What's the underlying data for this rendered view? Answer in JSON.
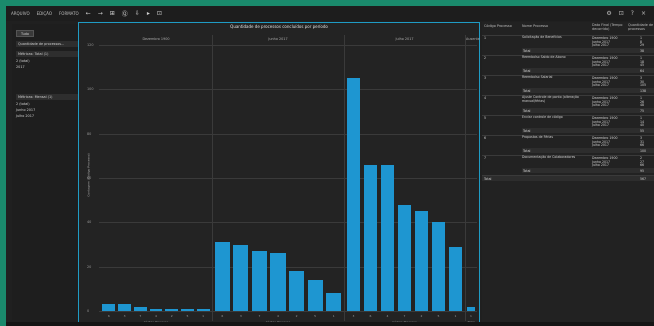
{
  "menu": {
    "items": [
      "ARQUIVO",
      "EDIÇÃO",
      "FORMATO"
    ],
    "tools": [
      "←",
      "→",
      "⊞",
      "Ⓠ",
      "⇩",
      "▸",
      "⊡"
    ],
    "right_tools": [
      "⚙",
      "⊡",
      "?",
      "×"
    ]
  },
  "left": {
    "button": "Tudo",
    "field_title": "Quantidade de processos...",
    "filter1_title": "Métricas: Total (1)",
    "filter1_items": [
      "2 (total)",
      "2017"
    ],
    "filter2_title": "Métricas: Mensal (1)",
    "filter2_items": [
      "2 (total)",
      "Junho 2017",
      "Julho 2017"
    ]
  },
  "chart_data": {
    "type": "bar",
    "title": "Quantidade de processos concluídos por período",
    "ylabel": "Contagem (Código Processo)",
    "ylim": [
      0,
      120
    ],
    "yticks": [
      0,
      20,
      40,
      60,
      80,
      100,
      120
    ],
    "groups": [
      {
        "period": "Dezembro 1900",
        "xlabel": "Código Processo",
        "categories": [
          "6",
          "3",
          "7",
          "4",
          "2",
          "5",
          "1"
        ],
        "values": [
          3,
          3,
          2,
          1,
          1,
          1,
          1
        ]
      },
      {
        "period": "Junho 2017",
        "xlabel": "Código Processo",
        "categories": [
          "6",
          "3",
          "7",
          "4",
          "2",
          "5",
          "1"
        ],
        "values": [
          31,
          30,
          27,
          26,
          18,
          14,
          8
        ]
      },
      {
        "period": "Julho 2017",
        "xlabel": "Código Processo",
        "categories": [
          "3",
          "6",
          "4",
          "7",
          "2",
          "5",
          "1"
        ],
        "values": [
          105,
          66,
          66,
          48,
          45,
          40,
          29
        ]
      },
      {
        "period": "Ausente",
        "xlabel": "Total",
        "categories": [
          "1"
        ],
        "values": [
          2
        ]
      }
    ]
  },
  "table": {
    "headers": [
      "Código Processo",
      "Nome Processo",
      "Data Final (Tempo decorrido)",
      "Quantidade de processos"
    ],
    "rows": [
      {
        "code": "1",
        "name": "Solicitação de Benefícios",
        "dates": [
          "Dezembro 1900",
          "Junho 2017",
          "Julho 2017"
        ],
        "vals": [
          "1",
          "8",
          "29"
        ],
        "total": "38"
      },
      {
        "code": "2",
        "name": "Reembolso Saldo de Abono",
        "dates": [
          "Dezembro 1900",
          "Junho 2017",
          "Julho 2017"
        ],
        "vals": [
          "1",
          "18",
          "45"
        ],
        "total": "64"
      },
      {
        "code": "3",
        "name": "Reembolso Salarial",
        "dates": [
          "Dezembro 1900",
          "Junho 2017",
          "Julho 2017"
        ],
        "vals": [
          "3",
          "30",
          "105"
        ],
        "total": "138"
      },
      {
        "code": "4",
        "name": "Ajuste Controle de ponto (alteração manual/férias)",
        "dates": [
          "Dezembro 1900",
          "Junho 2017",
          "Julho 2017"
        ],
        "vals": [
          "1",
          "26",
          "48"
        ],
        "total": "75"
      },
      {
        "code": "5",
        "name": "Enviar controle de código",
        "dates": [
          "Dezembro 1900",
          "Junho 2017",
          "Julho 2017"
        ],
        "vals": [
          "1",
          "14",
          "40"
        ],
        "total": "55"
      },
      {
        "code": "6",
        "name": "Propostas de Férias",
        "dates": [
          "Dezembro 1900",
          "Junho 2017",
          "Julho 2017"
        ],
        "vals": [
          "3",
          "31",
          "66"
        ],
        "total": "100"
      },
      {
        "code": "7",
        "name": "Documentação de Colaboradores",
        "dates": [
          "Dezembro 1900",
          "Junho 2017",
          "Julho 2017"
        ],
        "vals": [
          "2",
          "27",
          "66"
        ],
        "total": "95"
      }
    ],
    "total_label": "Total",
    "subtotal_label": "Total",
    "grand_total": "567"
  }
}
